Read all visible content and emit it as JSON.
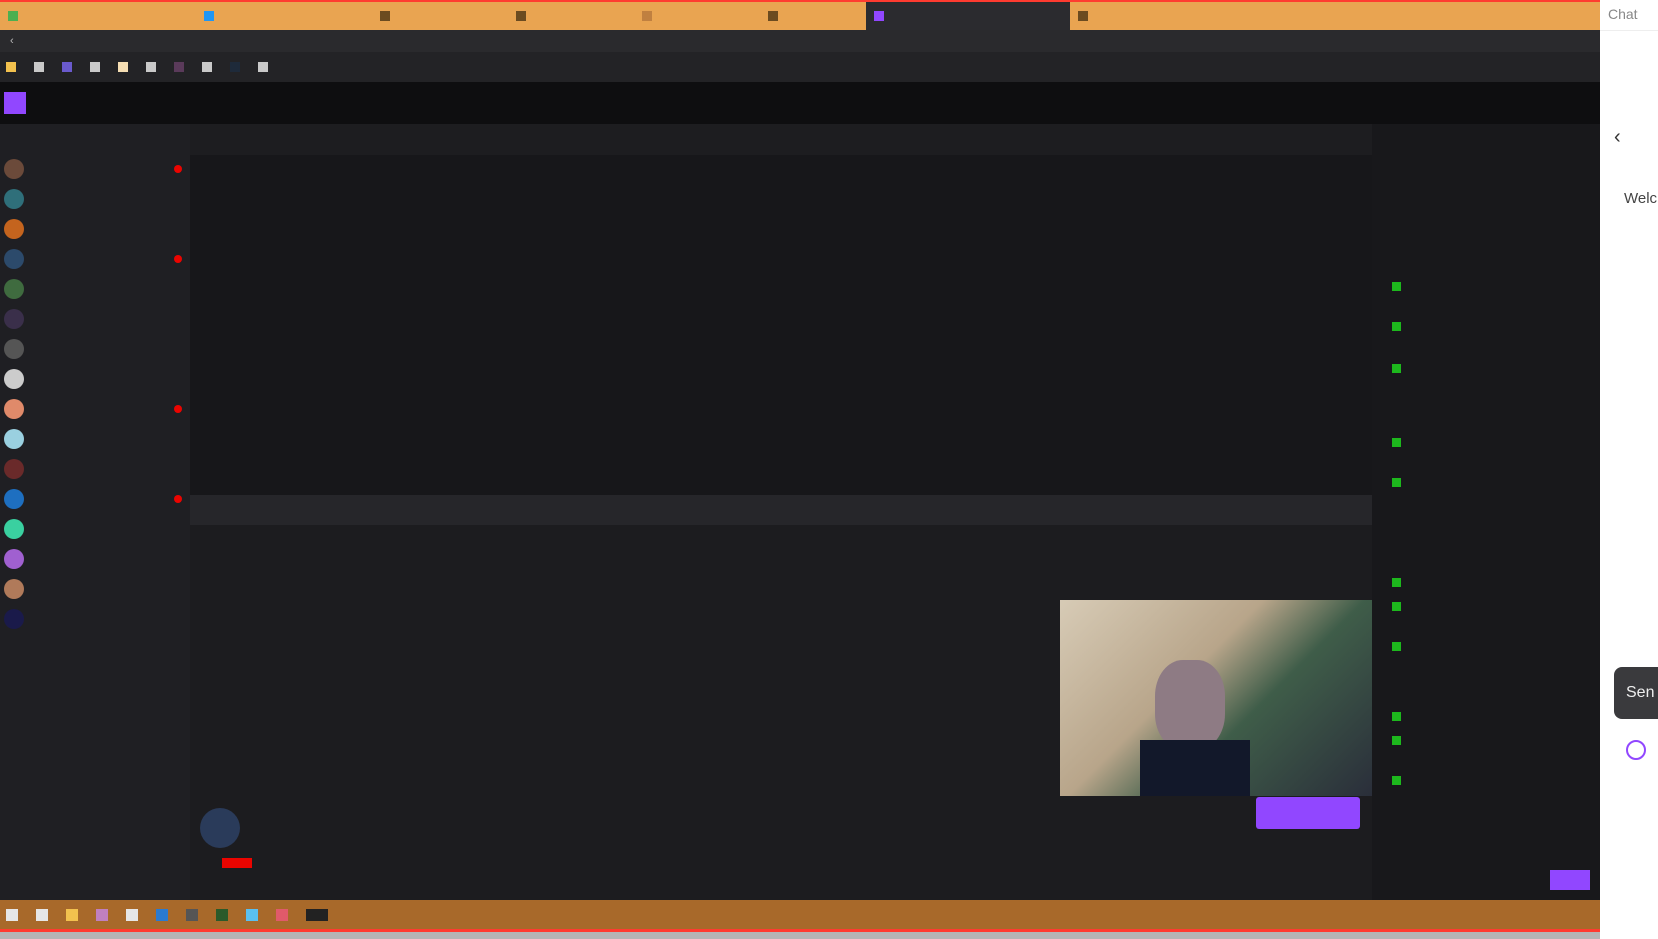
{
  "browser": {
    "tabs": [
      {
        "label": ""
      },
      {
        "label": ""
      },
      {
        "label": ""
      },
      {
        "label": ""
      },
      {
        "label": ""
      },
      {
        "label": ""
      },
      {
        "label": "",
        "active": true
      },
      {
        "label": ""
      }
    ],
    "url": "",
    "bookmarks": [
      "",
      "",
      "",
      "",
      "",
      "",
      "",
      "",
      "",
      ""
    ]
  },
  "site": {
    "nav": [
      "",
      "",
      "",
      ""
    ]
  },
  "sidebar": {
    "channels": [
      {
        "name": "",
        "live": true
      },
      {
        "name": "",
        "live": false
      },
      {
        "name": "",
        "live": false
      },
      {
        "name": "",
        "live": true
      },
      {
        "name": "",
        "live": false
      },
      {
        "name": "",
        "live": false
      },
      {
        "name": "",
        "live": false
      },
      {
        "name": "",
        "live": false
      },
      {
        "name": "",
        "live": true
      },
      {
        "name": "",
        "live": false
      },
      {
        "name": "",
        "live": false
      },
      {
        "name": "",
        "live": true
      },
      {
        "name": "",
        "live": false
      },
      {
        "name": "",
        "live": false
      },
      {
        "name": "",
        "live": false
      },
      {
        "name": "",
        "live": false
      }
    ]
  },
  "player": {
    "top_title": "",
    "info_line": ""
  },
  "streamer": {
    "name": "",
    "title": "",
    "subscribe_label": ""
  },
  "chat": {
    "messages": [
      "",
      "",
      "",
      "",
      "",
      "",
      "",
      "",
      "",
      "",
      "",
      "",
      "",
      "",
      "",
      "",
      "",
      "",
      "",
      "",
      "",
      "",
      "",
      "",
      "",
      "",
      "",
      "",
      ""
    ]
  },
  "popout": {
    "title": "Chat",
    "welcome": "Welc",
    "send_label": "Sen"
  },
  "colors": {
    "accent": "#9147ff",
    "live": "#eb0400",
    "tabstrip": "#e9a451",
    "taskbar": "#a8692a"
  }
}
